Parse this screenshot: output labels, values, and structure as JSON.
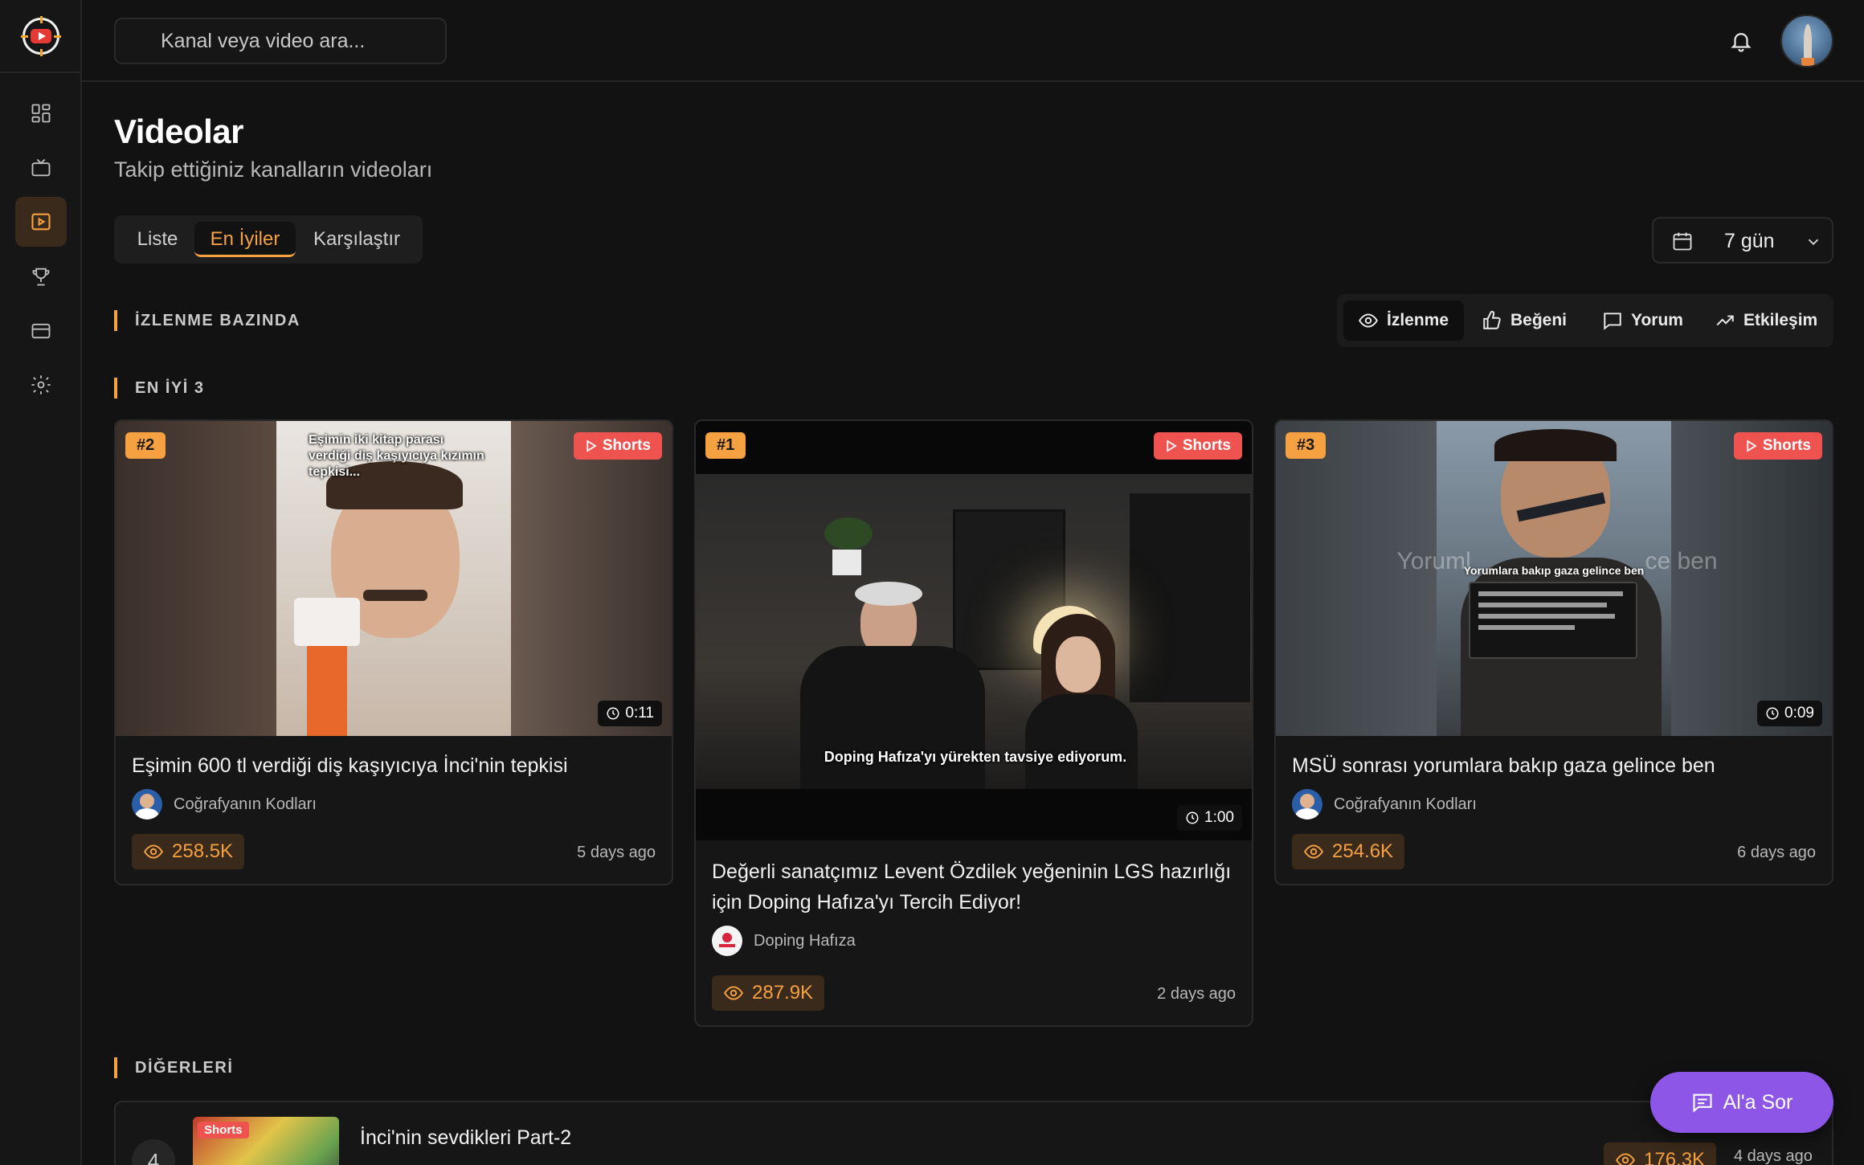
{
  "header": {
    "search_placeholder": "Kanal veya video ara..."
  },
  "page": {
    "title": "Videolar",
    "subtitle": "Takip ettiğiniz kanalların videoları"
  },
  "tabs": [
    {
      "label": "Liste",
      "active": false
    },
    {
      "label": "En İyiler",
      "active": true
    },
    {
      "label": "Karşılaştır",
      "active": false
    }
  ],
  "range": {
    "value": "7 gün"
  },
  "sections": {
    "basis": "İZLENME BAZINDA",
    "top3": "EN İYİ 3",
    "others": "DİĞERLERİ"
  },
  "metrics": [
    {
      "label": "İzlenme",
      "active": true
    },
    {
      "label": "Beğeni",
      "active": false
    },
    {
      "label": "Yorum",
      "active": false
    },
    {
      "label": "Etkileşim",
      "active": false
    }
  ],
  "cards": [
    {
      "rank": "#2",
      "badge": "Shorts",
      "duration": "0:11",
      "title": "Eşimin 600 tl verdiği diş kaşıyıcıya İnci'nin tepkisi",
      "channel": "Coğrafyanın Kodları",
      "views": "258.5K",
      "ago": "5 days ago",
      "overlay": "Eşimin iki kitap parası verdiği diş kaşıyıcıya kızımın tepkisi..."
    },
    {
      "rank": "#1",
      "badge": "Shorts",
      "duration": "1:00",
      "title": "Değerli sanatçımız Levent Özdilek yeğeninin LGS hazırlığı için Doping Hafıza'yı Tercih Ediyor!",
      "channel": "Doping Hafıza",
      "views": "287.9K",
      "ago": "2 days ago",
      "overlay": "Doping Hafıza'yı yürekten tavsiye ediyorum."
    },
    {
      "rank": "#3",
      "badge": "Shorts",
      "duration": "0:09",
      "title": "MSÜ sonrası yorumlara bakıp gaza gelince ben",
      "channel": "Coğrafyanın Kodları",
      "views": "254.6K",
      "ago": "6 days ago",
      "overlay": "Yorumlara bakıp gaza gelince ben"
    }
  ],
  "others": [
    {
      "num": "4",
      "badge": "Shorts",
      "title": "İnci'nin sevdikleri Part-2",
      "views": "176.3K",
      "ago": "4 days ago"
    }
  ],
  "ask_button": "Al'a Sor",
  "colors": {
    "accent": "#f5a041",
    "shorts": "#ef5350",
    "ask": "#8e56e6"
  }
}
